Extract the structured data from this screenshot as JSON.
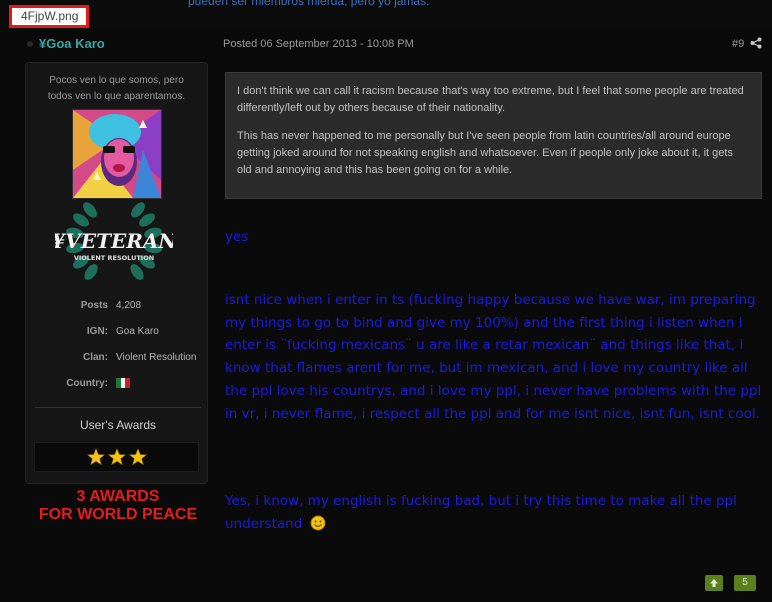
{
  "top_fragment": "pueden ser miembros mierda, pero yo jamás.",
  "filename_tag": "4FjpW.png",
  "post": {
    "username": "¥Goa Karo",
    "posted": "Posted 06 September 2013 - 10:08 PM",
    "post_number": "#9",
    "reputation": "5"
  },
  "profile": {
    "signature_line1": "Pocos ven lo que somos, pero",
    "signature_line2": "todos ven lo que aparentamos.",
    "badge_title": "¥VETERAN",
    "badge_subtitle": "VIOLENT RESOLUTION",
    "stats": [
      {
        "label": "Posts",
        "value": "4,208"
      },
      {
        "label": "IGN:",
        "value": "Goa Karo"
      },
      {
        "label": "Clan:",
        "value": "Violent Resolution"
      },
      {
        "label": "Country:",
        "value": ""
      }
    ],
    "awards_title": "User's Awards",
    "award_count": 3,
    "caption_line1": "3 AWARDS",
    "caption_line2": "FOR WORLD PEACE"
  },
  "quote": {
    "paragraph1": "I don't think we can call it racism because that's way too extreme, but I feel that some people are treated differently/left out by others because of their nationality.",
    "paragraph2": "This has never happened to me personally but I've seen people from latin countries/all around europe getting joked around for not speaking english and whatsoever. Even if people only joke about it, it gets old and annoying and this has been going on for a while."
  },
  "reply": {
    "line1": "yes",
    "paragraph2": "isnt nice when i enter in ts (fucking happy because we have war, im preparing my things to go to bind and give my 100%) and the first thing i listen when i enter is ¨fucking mexicans¨ u are like a retar mexican¨ and things like that, i know that flames arent for me, but im mexican, and i love my country like all the ppl love his countrys, and i love my ppl, i never have problems with the ppl in vr, i never flame, i respect all the ppl and for me isnt nice, isnt fun, isnt cool.",
    "paragraph3": "Yes, i know, my english is fucking bad, but i try this time to make all the ppl understand"
  },
  "icons": {
    "share": "share-icon",
    "thumb": "thumbs-up-icon",
    "smiley": "smiley-icon",
    "star": "star-icon",
    "flag": "mexico-flag-icon"
  },
  "colors": {
    "username": "#34a6a6",
    "reply_text": "#1b1bdd",
    "caption": "#e51c1c",
    "rep_green": "#5b7f1e"
  }
}
